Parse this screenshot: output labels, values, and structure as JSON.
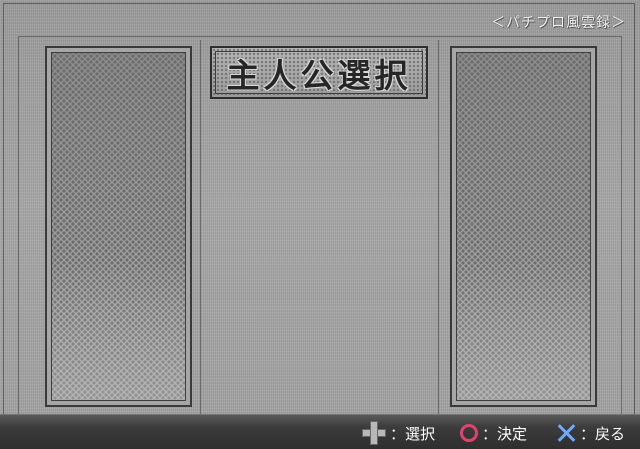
{
  "header": {
    "source_label": "＜パチプロ風雲録＞"
  },
  "title": "主人公選択",
  "controls": [
    {
      "icon": "dpad-icon",
      "label": "：選択"
    },
    {
      "icon": "circle-button-icon",
      "label": "：決定",
      "color": "#e0446e"
    },
    {
      "icon": "cross-button-icon",
      "label": "：戻る",
      "color": "#6fa8ff"
    }
  ]
}
